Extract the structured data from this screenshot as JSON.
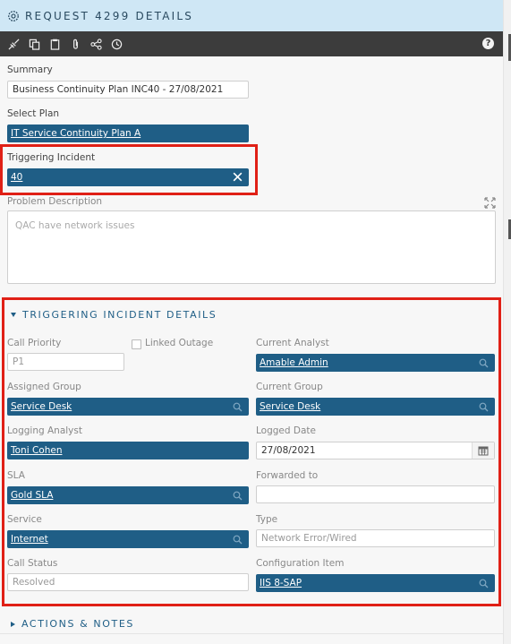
{
  "header": {
    "title": "REQUEST 4299 DETAILS"
  },
  "toolbar": {
    "icons": [
      "merge-icon",
      "copy-icon",
      "clipboard-icon",
      "paperclip-icon",
      "share-icon",
      "clock-icon"
    ],
    "help": "?"
  },
  "form": {
    "summary_label": "Summary",
    "summary_value": "Business Continuity Plan INC40 - 27/08/2021",
    "select_plan_label": "Select Plan",
    "select_plan_value": "IT Service Continuity Plan A",
    "triggering_incident_label": "Triggering Incident",
    "triggering_incident_value": "40",
    "problem_description_label": "Problem Description",
    "problem_description_value": "QAC have network issues"
  },
  "incident_section": {
    "title": "TRIGGERING INCIDENT DETAILS",
    "call_priority_label": "Call Priority",
    "call_priority_value": "P1",
    "linked_outage_label": "Linked Outage",
    "current_analyst_label": "Current Analyst",
    "current_analyst_value": "Amable Admin",
    "assigned_group_label": "Assigned Group",
    "assigned_group_value": "Service Desk",
    "current_group_label": "Current Group",
    "current_group_value": "Service Desk",
    "logging_analyst_label": "Logging Analyst",
    "logging_analyst_value": "Toni Cohen",
    "logged_date_label": "Logged Date",
    "logged_date_value": "27/08/2021",
    "sla_label": "SLA",
    "sla_value": "Gold SLA",
    "forwarded_to_label": "Forwarded to",
    "forwarded_to_value": "",
    "service_label": "Service",
    "service_value": "Internet",
    "type_label": "Type",
    "type_value": "Network Error/Wired",
    "call_status_label": "Call Status",
    "call_status_value": "Resolved",
    "configuration_item_label": "Configuration Item",
    "configuration_item_value": "IIS 8-SAP"
  },
  "actions_section": {
    "title": "ACTIONS & NOTES"
  },
  "colors": {
    "accent": "#1f5e86",
    "highlight": "#e02016",
    "titlebar": "#cfe7f5",
    "toolbar": "#3c3c3c"
  }
}
